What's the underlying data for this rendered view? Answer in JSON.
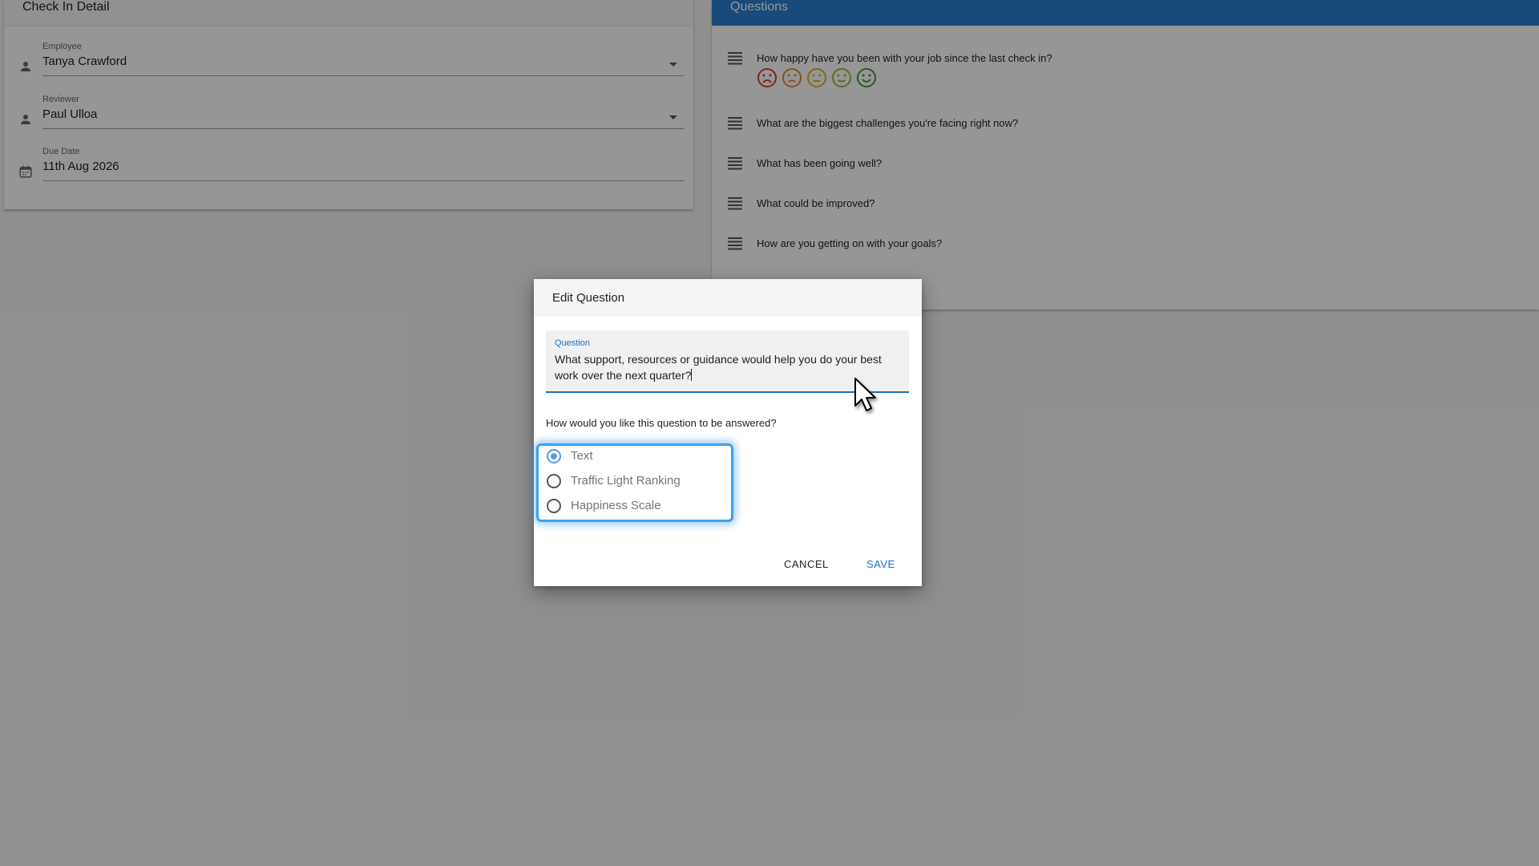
{
  "left_card": {
    "title": "Check In Detail",
    "employee": {
      "label": "Employee",
      "value": "Tanya Crawford",
      "icon": "person-icon"
    },
    "reviewer": {
      "label": "Reviewer",
      "value": "Paul Ulloa",
      "icon": "person-icon"
    },
    "due_date": {
      "label": "Due Date",
      "value": "11th Aug 2026",
      "icon": "calendar-icon"
    }
  },
  "right_card": {
    "title": "Questions",
    "items": [
      {
        "text": "How happy have you been with your job since the last check in?",
        "icon": "text-lines-icon"
      },
      {
        "text": "What are the biggest challenges you're facing right now?",
        "icon": "text-lines-icon"
      },
      {
        "text": "What has been going well?",
        "icon": "text-lines-icon"
      },
      {
        "text": "What could be improved?",
        "icon": "text-lines-icon"
      },
      {
        "text": "How are you getting on with your goals?",
        "icon": "text-lines-icon"
      }
    ],
    "happiness_faces": [
      {
        "mood": "very-sad",
        "color": "#d9402b"
      },
      {
        "mood": "sad",
        "color": "#e8862a"
      },
      {
        "mood": "neutral",
        "color": "#e0b02a"
      },
      {
        "mood": "happy",
        "color": "#9bb73a"
      },
      {
        "mood": "very-happy",
        "color": "#3f9c3a"
      }
    ]
  },
  "dialog": {
    "title": "Edit Question",
    "question_label": "Question",
    "question_value": "What support, resources or guidance would help you do your best work over the next quarter?",
    "answer_prompt": "How would you like this question to be answered?",
    "options": [
      {
        "label": "Text",
        "selected": true
      },
      {
        "label": "Traffic Light Ranking",
        "selected": false
      },
      {
        "label": "Happiness Scale",
        "selected": false
      }
    ],
    "cancel_label": "CANCEL",
    "save_label": "SAVE"
  },
  "colors": {
    "accent": "#1a6fc2",
    "header_blue": "#2a7fcf",
    "focus_ring": "#3ea0ee"
  }
}
